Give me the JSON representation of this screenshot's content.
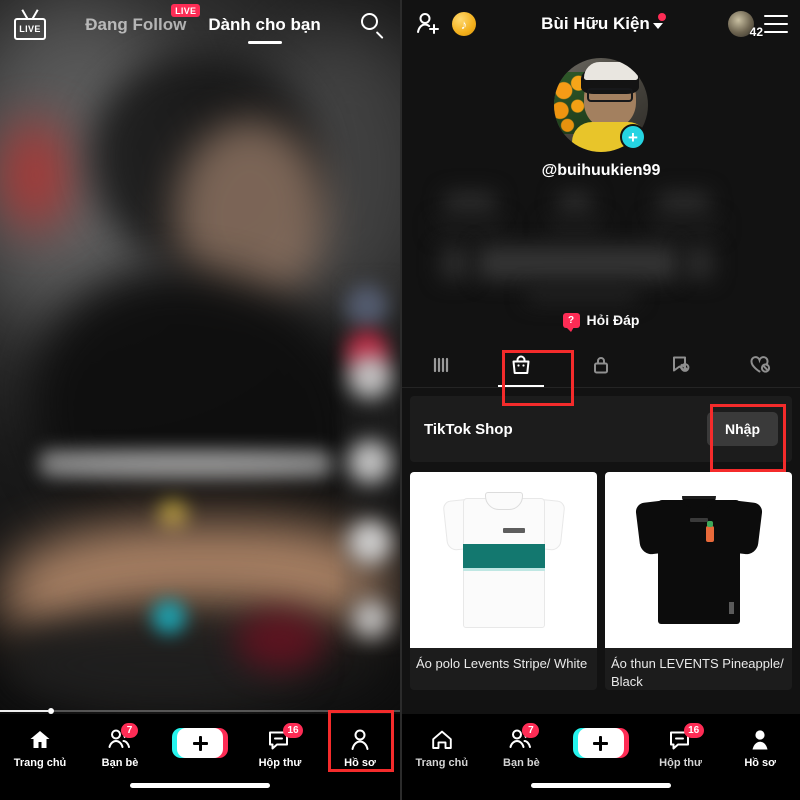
{
  "left_panel": {
    "top_bar": {
      "live_icon_label": "LIVE",
      "tabs": [
        {
          "label": "Đang Follow",
          "active": false,
          "badge": "LIVE"
        },
        {
          "label": "Dành cho bạn",
          "active": true,
          "badge": ""
        }
      ],
      "search_icon": "search-icon"
    },
    "bottom_nav": {
      "items": [
        {
          "label": "Trang chủ",
          "icon": "home-icon",
          "badge": "",
          "active": true
        },
        {
          "label": "Bạn bè",
          "icon": "friends-icon",
          "badge": "7",
          "active": false
        },
        {
          "label": "",
          "icon": "create-plus-icon",
          "badge": "",
          "active": false
        },
        {
          "label": "Hộp thư",
          "icon": "inbox-icon",
          "badge": "16",
          "active": false
        },
        {
          "label": "Hồ sơ",
          "icon": "profile-icon",
          "badge": "",
          "active": false
        }
      ]
    },
    "highlight": {
      "target": "Hồ sơ",
      "color": "#f42b2b"
    }
  },
  "right_panel": {
    "top_bar": {
      "add_friend_icon": "add-person-icon",
      "coin_icon": "tiktok-coin-icon",
      "username": "Bùi Hữu Kiện",
      "has_notification_dot": true,
      "avatar_badge": "42",
      "menu_icon": "hamburger-menu-icon"
    },
    "profile": {
      "handle": "@buihuukien99",
      "follow_badge": "+",
      "qa_label": "Hỏi Đáp",
      "qa_icon_glyph": "?"
    },
    "profile_tabs": [
      {
        "name": "posts-grid-tab",
        "icon": "grid-icon",
        "active": false
      },
      {
        "name": "shop-tab",
        "icon": "shopping-bag-icon",
        "active": true
      },
      {
        "name": "private-tab",
        "icon": "lock-icon",
        "active": false
      },
      {
        "name": "saved-tab",
        "icon": "bookmark-slash-icon",
        "active": false
      },
      {
        "name": "liked-tab",
        "icon": "heart-slash-icon",
        "active": false
      }
    ],
    "shop": {
      "title": "TikTok Shop",
      "enter_button": "Nhập",
      "products": [
        {
          "name": "Áo polo Levents Stripe/ White",
          "image": "white-polo-teal-stripe"
        },
        {
          "name": "Áo thun LEVENTS Pineapple/ Black",
          "image": "black-tee-pineapple"
        }
      ]
    },
    "bottom_nav": {
      "items": [
        {
          "label": "Trang chủ",
          "icon": "home-icon",
          "badge": "",
          "active": false
        },
        {
          "label": "Bạn bè",
          "icon": "friends-icon",
          "badge": "7",
          "active": false
        },
        {
          "label": "",
          "icon": "create-plus-icon",
          "badge": "",
          "active": false
        },
        {
          "label": "Hộp thư",
          "icon": "inbox-icon",
          "badge": "16",
          "active": false
        },
        {
          "label": "Hồ sơ",
          "icon": "profile-icon",
          "badge": "",
          "active": true
        }
      ]
    },
    "highlights": [
      {
        "target": "shop-tab",
        "color": "#f42b2b"
      },
      {
        "target": "Nhập",
        "color": "#f42b2b"
      }
    ]
  },
  "colors": {
    "accent_pink": "#fe2c55",
    "accent_cyan": "#25f4ee",
    "highlight_red": "#f42b2b",
    "coin_gold": "#f3b01c",
    "polo_stripe_teal": "#13786f"
  }
}
